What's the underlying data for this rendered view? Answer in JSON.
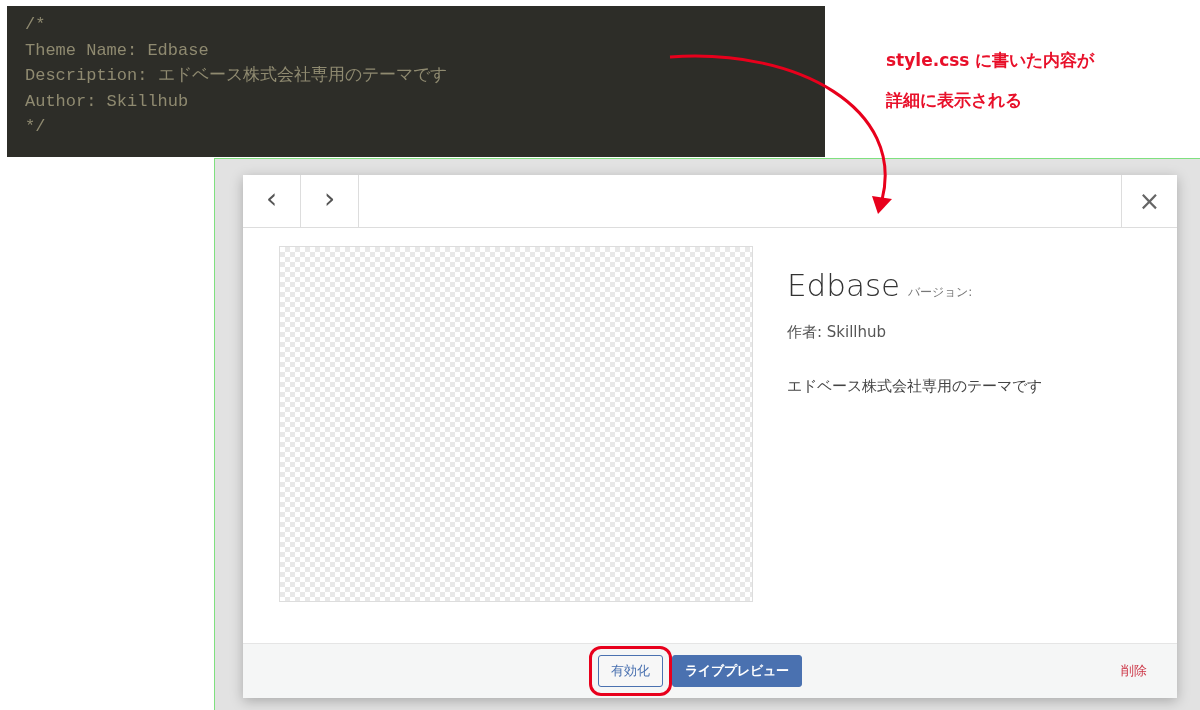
{
  "code_panel": {
    "lines": [
      "/*",
      "Theme Name: Edbase",
      "Description: エドベース株式会社専用のテーマです",
      "Author: Skillhub",
      "*/"
    ]
  },
  "annotation": {
    "lines": [
      "style.css に書いた内容が",
      "詳細に表示される"
    ]
  },
  "theme_modal": {
    "nav": [
      "‹",
      "›"
    ],
    "close": "×",
    "theme_name": "Edbase",
    "version_label": "バージョン:",
    "author": "作者: Skillhub",
    "description": "エドベース株式会社専用のテーマです",
    "actions": [
      {
        "kind": "secondary",
        "label": "有効化",
        "highlighted": true
      },
      {
        "kind": "primary",
        "label": "ライブプレビュー",
        "highlighted": false
      }
    ],
    "delete": "削除"
  }
}
